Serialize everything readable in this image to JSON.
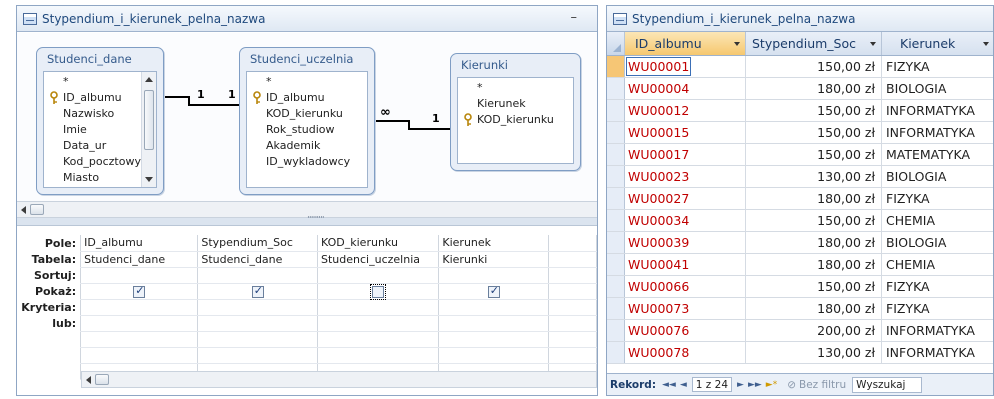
{
  "query_window": {
    "title": "Stypendium_i_kierunek_pelna_nazwa",
    "minimize": "–",
    "tables": [
      {
        "name": "Studenci_dane",
        "fields": [
          "*",
          "ID_albumu",
          "Nazwisko",
          "Imie",
          "Data_ur",
          "Kod_pocztowy",
          "Miasto"
        ],
        "key_field": "ID_albumu"
      },
      {
        "name": "Studenci_uczelnia",
        "fields": [
          "*",
          "ID_albumu",
          "KOD_kierunku",
          "Rok_studiow",
          "Akademik",
          "ID_wykladowcy"
        ],
        "key_field": "ID_albumu"
      },
      {
        "name": "Kierunki",
        "fields": [
          "*",
          "Kierunek",
          "KOD_kierunku"
        ],
        "key_field": "KOD_kierunku"
      }
    ],
    "relationships": [
      {
        "left": "1",
        "right": "1"
      },
      {
        "left": "∞",
        "right": "1"
      }
    ],
    "splitter_grip": "·········",
    "grid": {
      "row_labels": [
        "Pole:",
        "Tabela:",
        "Sortuj:",
        "Pokaż:",
        "Kryteria:",
        "lub:"
      ],
      "columns": [
        {
          "field": "ID_albumu",
          "table": "Studenci_dane",
          "show": true,
          "focused": false
        },
        {
          "field": "Stypendium_Soc",
          "table": "Studenci_dane",
          "show": true,
          "focused": false
        },
        {
          "field": "KOD_kierunku",
          "table": "Studenci_uczelnia",
          "show": false,
          "focused": true
        },
        {
          "field": "Kierunek",
          "table": "Kierunki",
          "show": true,
          "focused": false
        }
      ]
    }
  },
  "datasheet_window": {
    "title": "Stypendium_i_kierunek_pelna_nazwa",
    "columns": [
      "ID_albumu",
      "Stypendium_Soc",
      "Kierunek"
    ],
    "rows": [
      [
        "WU00001",
        "150,00 zł",
        "FIZYKA"
      ],
      [
        "WU00004",
        "180,00 zł",
        "BIOLOGIA"
      ],
      [
        "WU00012",
        "150,00 zł",
        "INFORMATYKA"
      ],
      [
        "WU00015",
        "150,00 zł",
        "INFORMATYKA"
      ],
      [
        "WU00017",
        "150,00 zł",
        "MATEMATYKA"
      ],
      [
        "WU00023",
        "130,00 zł",
        "BIOLOGIA"
      ],
      [
        "WU00027",
        "180,00 zł",
        "FIZYKA"
      ],
      [
        "WU00034",
        "150,00 zł",
        "CHEMIA"
      ],
      [
        "WU00039",
        "180,00 zł",
        "BIOLOGIA"
      ],
      [
        "WU00041",
        "180,00 zł",
        "CHEMIA"
      ],
      [
        "WU00066",
        "150,00 zł",
        "FIZYKA"
      ],
      [
        "WU00073",
        "180,00 zł",
        "FIZYKA"
      ],
      [
        "WU00076",
        "200,00 zł",
        "INFORMATYKA"
      ],
      [
        "WU00078",
        "130,00 zł",
        "INFORMATYKA"
      ]
    ],
    "current_row": 0,
    "navigation": {
      "label": "Rekord:",
      "first": "◄◄",
      "prev": "◄",
      "position": "1 z 24",
      "next": "►",
      "last": "►►",
      "new": "►*",
      "filter": "Bez filtru",
      "search": "Wyszukaj"
    }
  },
  "colors": {
    "accent": "#1f497d",
    "id_text": "#c00000",
    "current_row": "#f6c675"
  }
}
